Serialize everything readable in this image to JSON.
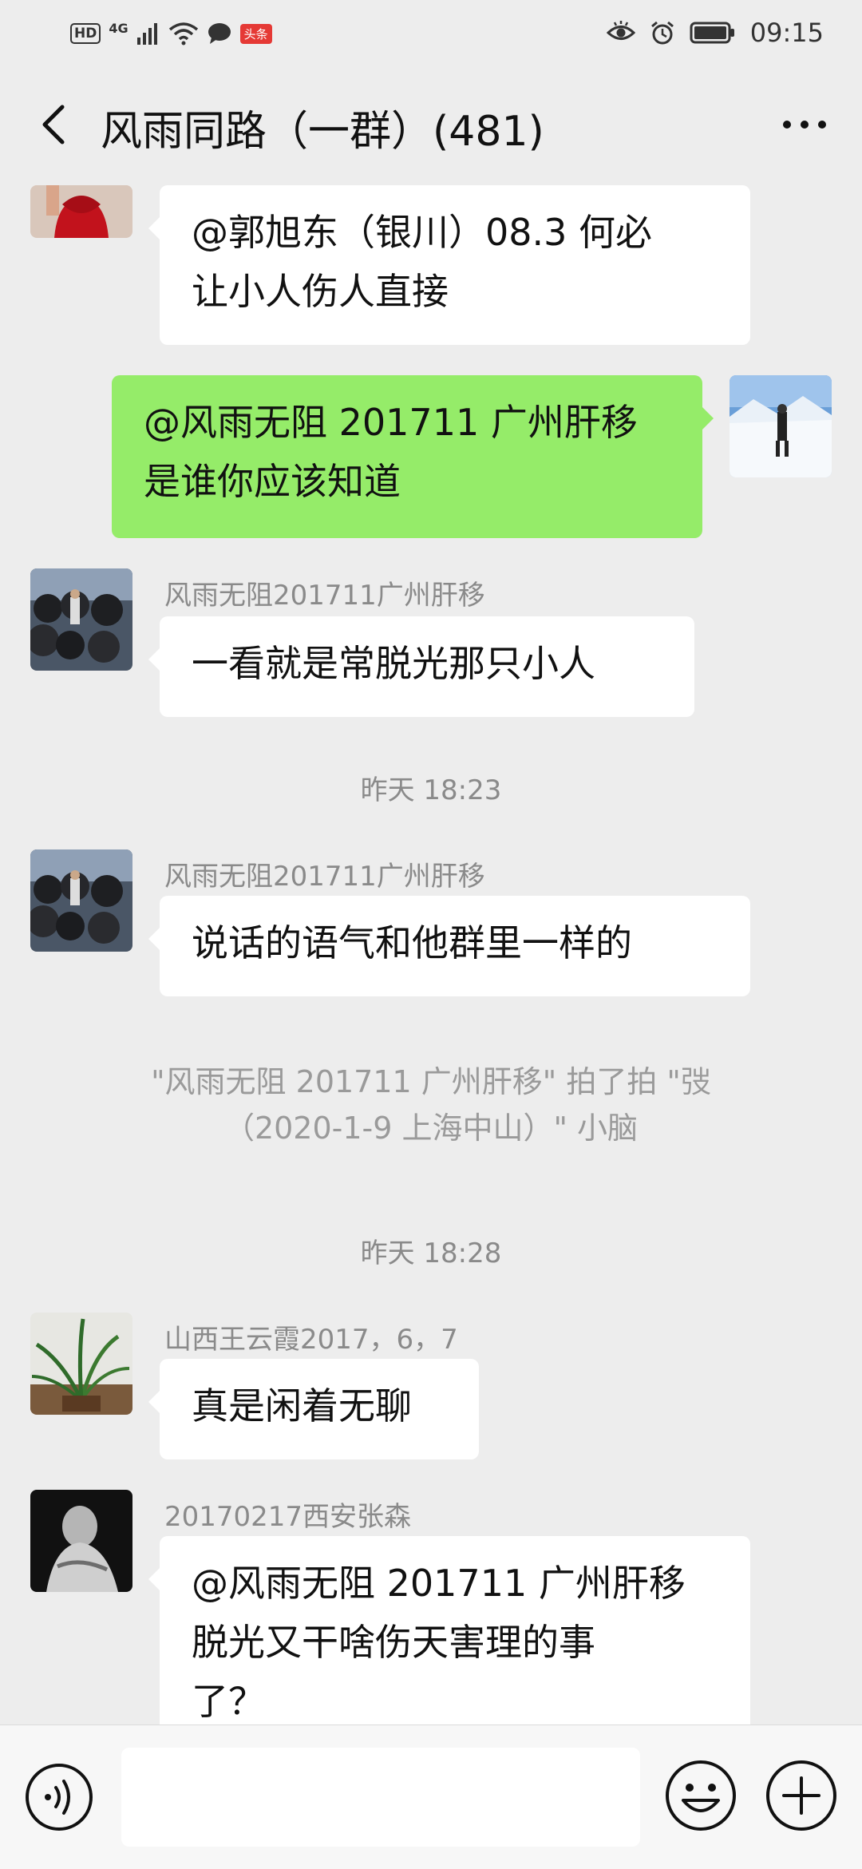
{
  "status_bar": {
    "hd": "HD",
    "network": "4G",
    "news_badge": "头条",
    "time": "09:15",
    "icons": [
      "hd-icon",
      "signal-icon",
      "wifi-icon",
      "chat-notification-icon",
      "eye-icon",
      "alarm-icon",
      "battery-icon"
    ]
  },
  "header": {
    "title": "风雨同路（一群）(481)",
    "back_icon": "back-arrow-icon",
    "more_icon": "more-dots-icon"
  },
  "messages": [
    {
      "direction": "incoming",
      "sender": "",
      "lines": [
        "@郭旭东（银川）08.3  何必",
        "让小人伤人直接"
      ],
      "avatar": "avatar-red-dress"
    },
    {
      "direction": "outgoing",
      "lines": [
        "@风雨无阻 201711 广州肝移",
        " 是谁你应该知道"
      ],
      "avatar": "avatar-snow-skier"
    },
    {
      "direction": "incoming",
      "sender": "风雨无阻201711广州肝移",
      "lines": [
        "一看就是常脱光那只小人"
      ],
      "avatar": "avatar-tires"
    },
    {
      "type": "timestamp",
      "text": "昨天 18:23"
    },
    {
      "direction": "incoming",
      "sender": "风雨无阻201711广州肝移",
      "lines": [
        "说话的语气和他群里一样的"
      ],
      "avatar": "avatar-tires"
    },
    {
      "type": "system",
      "lines": [
        "\"风雨无阻 201711 广州肝移\" 拍了拍 \"弢",
        "（2020-1-9 上海中山）\" 小脑"
      ]
    },
    {
      "type": "timestamp",
      "text": "昨天 18:28"
    },
    {
      "direction": "incoming",
      "sender": "山西王云霞2017，6，7",
      "lines": [
        "真是闲着无聊"
      ],
      "avatar": "avatar-orchid"
    },
    {
      "direction": "incoming",
      "sender": "20170217西安张森",
      "lines": [
        "@风雨无阻 201711 广州肝移",
        " 脱光又干啥伤天害理的事",
        "了？"
      ],
      "avatar": "avatar-bw-figure"
    }
  ],
  "input_bar": {
    "text_value": "",
    "voice_icon": "voice-icon",
    "emoji_icon": "emoji-icon",
    "plus_icon": "plus-icon"
  }
}
